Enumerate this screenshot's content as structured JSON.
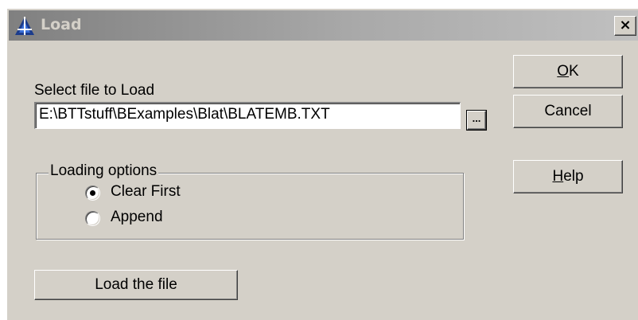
{
  "window": {
    "title": "Load",
    "close_label": "×"
  },
  "file": {
    "label": "Select file to Load",
    "path_value": "E:\\BTTstuff\\BExamples\\Blat\\BLATEMB.TXT",
    "browse_label": "..."
  },
  "options": {
    "legend": "Loading options",
    "clear_first_label": "Clear First",
    "append_label": "Append",
    "selected": "clear_first"
  },
  "buttons": {
    "ok_label_underlined": "O",
    "ok_label_rest": "K",
    "cancel_label": "Cancel",
    "help_label_underlined": "H",
    "help_label_rest": "elp",
    "load_label": "Load the file"
  },
  "colors": {
    "dialog_face": "#d4d0c8",
    "titlebar_inactive_start": "#808080",
    "titlebar_inactive_end": "#c0c0c0"
  },
  "icons": {
    "app": "triangle-logo-icon",
    "close": "close-icon"
  }
}
